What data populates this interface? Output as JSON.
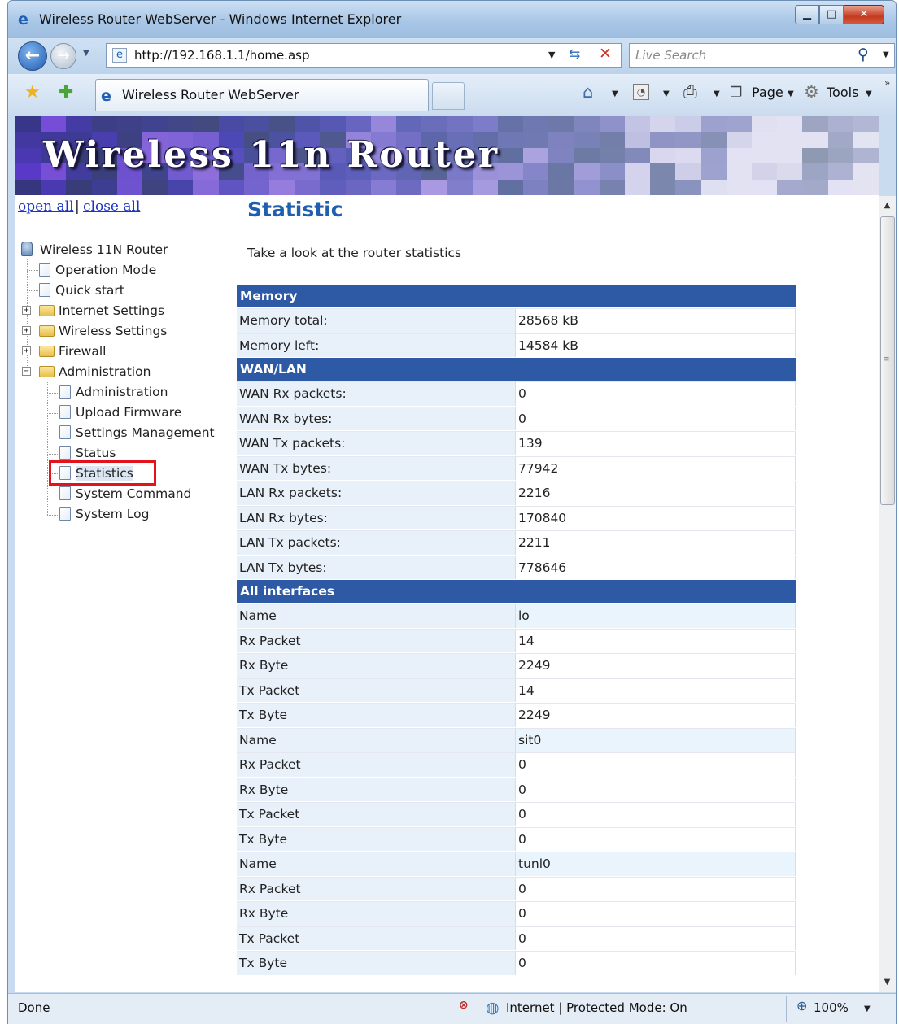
{
  "window": {
    "title": "Wireless Router WebServer - Windows Internet Explorer",
    "minimize_icon": "minimize-icon",
    "maximize_icon": "maximize-icon",
    "close_icon": "close-icon"
  },
  "address_bar": {
    "url": "http://192.168.1.1/home.asp",
    "search_placeholder": "Live Search"
  },
  "tabs": [
    {
      "label": "Wireless Router WebServer"
    }
  ],
  "command_bar": {
    "page_label": "Page",
    "tools_label": "Tools"
  },
  "banner": {
    "title": "Wireless 11n Router"
  },
  "sidebar": {
    "open_all": "open all",
    "separator": "|",
    "close_all": "close all",
    "root": "Wireless 11N Router",
    "items": [
      {
        "label": "Operation Mode"
      },
      {
        "label": "Quick start"
      },
      {
        "label": "Internet Settings"
      },
      {
        "label": "Wireless Settings"
      },
      {
        "label": "Firewall"
      },
      {
        "label": "Administration"
      }
    ],
    "admin_children": [
      {
        "label": "Administration"
      },
      {
        "label": "Upload Firmware"
      },
      {
        "label": "Settings Management"
      },
      {
        "label": "Status"
      },
      {
        "label": "Statistics"
      },
      {
        "label": "System Command"
      },
      {
        "label": "System Log"
      }
    ],
    "selected": "Statistics"
  },
  "main": {
    "title": "Statistic",
    "description": "Take a look at the router statistics",
    "sections": [
      {
        "header": "Memory",
        "rows": [
          {
            "label": "Memory total:",
            "value": "28568 kB"
          },
          {
            "label": "Memory left:",
            "value": "14584 kB"
          }
        ]
      },
      {
        "header": "WAN/LAN",
        "rows": [
          {
            "label": "WAN Rx packets:",
            "value": "0"
          },
          {
            "label": "WAN Rx bytes:",
            "value": "0"
          },
          {
            "label": "WAN Tx packets:",
            "value": "139"
          },
          {
            "label": "WAN Tx bytes:",
            "value": "77942"
          },
          {
            "label": "LAN Rx packets:",
            "value": "2216"
          },
          {
            "label": "LAN Rx bytes:",
            "value": "170840"
          },
          {
            "label": "LAN Tx packets:",
            "value": "2211"
          },
          {
            "label": "LAN Tx bytes:",
            "value": "778646"
          }
        ]
      },
      {
        "header": "All interfaces",
        "rows": [
          {
            "label": "Name",
            "value": "lo"
          },
          {
            "label": "Rx Packet",
            "value": "14"
          },
          {
            "label": "Rx Byte",
            "value": "2249"
          },
          {
            "label": "Tx Packet",
            "value": "14"
          },
          {
            "label": "Tx Byte",
            "value": "2249"
          },
          {
            "label": "Name",
            "value": "sit0"
          },
          {
            "label": "Rx Packet",
            "value": "0"
          },
          {
            "label": "Rx Byte",
            "value": "0"
          },
          {
            "label": "Tx Packet",
            "value": "0"
          },
          {
            "label": "Tx Byte",
            "value": "0"
          },
          {
            "label": "Name",
            "value": "tunl0"
          },
          {
            "label": "Rx Packet",
            "value": "0"
          },
          {
            "label": "Rx Byte",
            "value": "0"
          },
          {
            "label": "Tx Packet",
            "value": "0"
          },
          {
            "label": "Tx Byte",
            "value": "0"
          }
        ]
      }
    ]
  },
  "status_bar": {
    "status": "Done",
    "zone": "Internet | Protected Mode: On",
    "zoom": "100%"
  },
  "colors": {
    "section_header": "#2e5aa5",
    "title_blue": "#1f5fae",
    "highlight_red": "#e3131b",
    "link_blue": "#1b34c4"
  }
}
